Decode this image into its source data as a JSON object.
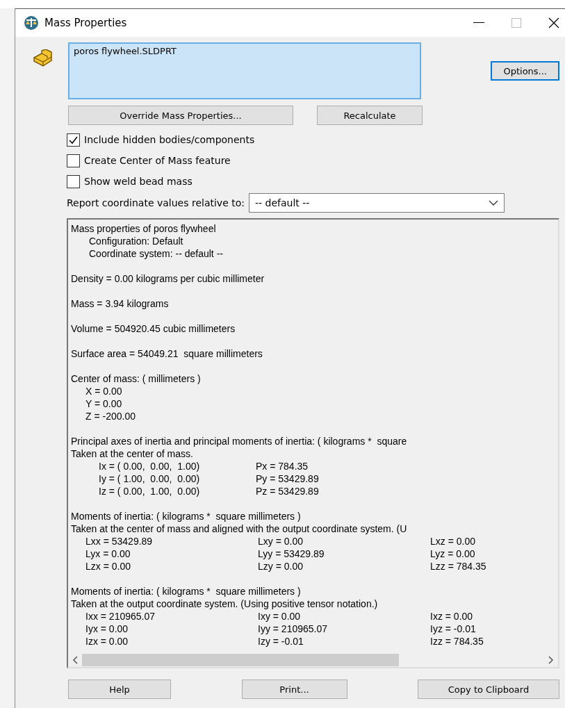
{
  "window": {
    "title": "Mass Properties"
  },
  "selection": {
    "value": "poros flywheel.SLDPRT"
  },
  "buttons_top": [
    {
      "label": "Options...",
      "focused": true
    }
  ],
  "action_buttons": [
    {
      "label": "Override Mass Properties..."
    },
    {
      "label": "Recalculate"
    }
  ],
  "checkboxes": [
    {
      "label": "Include hidden bodies/components",
      "checked": true
    },
    {
      "label": "Create Center of Mass feature",
      "checked": false
    },
    {
      "label": "Show weld bead mass",
      "checked": false
    }
  ],
  "coordinate": {
    "label": "Report coordinate values relative to:",
    "value": "-- default --"
  },
  "results": [
    [
      {
        "kind": "line",
        "text": "Mass properties of poros flywheel"
      },
      {
        "kind": "sub",
        "text": "Configuration: Default"
      },
      {
        "kind": "sub",
        "text": "Coordinate system: -- default --"
      }
    ],
    [
      {
        "kind": "line",
        "text": "Density = 0.00 kilograms per cubic millimeter"
      }
    ],
    [
      {
        "kind": "line",
        "text": "Mass = 3.94 kilograms"
      }
    ],
    [
      {
        "kind": "line",
        "text": "Volume = 504920.45 cubic millimeters"
      }
    ],
    [
      {
        "kind": "line",
        "text": "Surface area = 54049.21  square millimeters"
      }
    ],
    [
      {
        "kind": "line",
        "text": "Center of mass: ( millimeters )"
      },
      {
        "kind": "cells",
        "cells": [
          "X = 0.00"
        ]
      },
      {
        "kind": "cells",
        "cells": [
          "Y = 0.00"
        ]
      },
      {
        "kind": "cells",
        "cells": [
          "Z = -200.00"
        ]
      }
    ],
    [
      {
        "kind": "line",
        "text": "Principal axes of inertia and principal moments of inertia: ( kilograms *  square"
      },
      {
        "kind": "line",
        "text": "Taken at the center of mass."
      },
      {
        "kind": "axes",
        "cells": [
          "Ix = ( 0.00,  0.00,  1.00)",
          "Px = 784.35"
        ]
      },
      {
        "kind": "axes",
        "cells": [
          "Iy = ( 1.00,  0.00,  0.00)",
          "Py = 53429.89"
        ]
      },
      {
        "kind": "axes",
        "cells": [
          "Iz = ( 0.00,  1.00,  0.00)",
          "Pz = 53429.89"
        ]
      }
    ],
    [
      {
        "kind": "line",
        "text": "Moments of inertia: ( kilograms *  square millimeters )"
      },
      {
        "kind": "line",
        "text": "Taken at the center of mass and aligned with the output coordinate system. (U"
      },
      {
        "kind": "cells",
        "cells": [
          "Lxx = 53429.89",
          "Lxy = 0.00",
          "Lxz = 0.00"
        ]
      },
      {
        "kind": "cells",
        "cells": [
          "Lyx = 0.00",
          "Lyy = 53429.89",
          "Lyz = 0.00"
        ]
      },
      {
        "kind": "cells",
        "cells": [
          "Lzx = 0.00",
          "Lzy = 0.00",
          "Lzz = 784.35"
        ]
      }
    ],
    [
      {
        "kind": "line",
        "text": "Moments of inertia: ( kilograms *  square millimeters )"
      },
      {
        "kind": "line",
        "text": "Taken at the output coordinate system. (Using positive tensor notation.)"
      },
      {
        "kind": "cells",
        "cells": [
          "Ixx = 210965.07",
          "Ixy = 0.00",
          "Ixz = 0.00"
        ]
      },
      {
        "kind": "cells",
        "cells": [
          "Iyx = 0.00",
          "Iyy = 210965.07",
          "Iyz = -0.01"
        ]
      },
      {
        "kind": "cells",
        "cells": [
          "Izx = 0.00",
          "Izy = -0.01",
          "Izz = 784.35"
        ]
      }
    ]
  ],
  "bottom_buttons": [
    {
      "label": "Help"
    },
    {
      "label": "Print..."
    },
    {
      "label": "Copy to Clipboard"
    }
  ]
}
